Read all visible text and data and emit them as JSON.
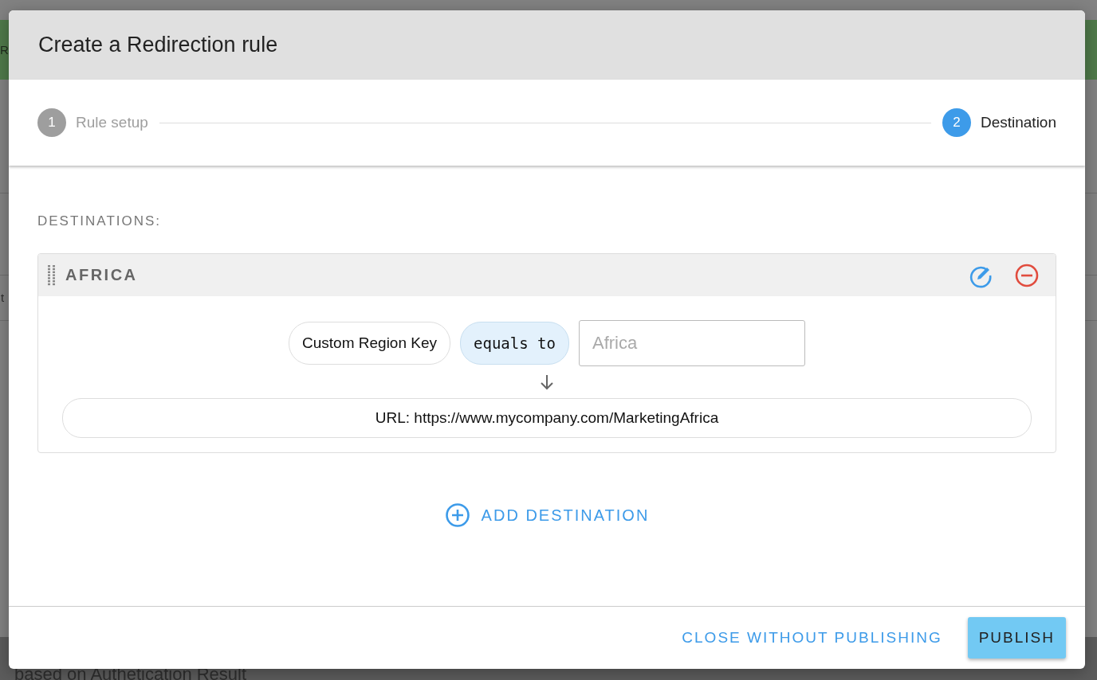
{
  "background": {
    "banner_text": "R",
    "row_text": "t",
    "footer_text": "based on Authetication Result"
  },
  "dialog": {
    "title": "Create a Redirection rule",
    "steps": [
      {
        "number": "1",
        "label": "Rule setup",
        "selected": false
      },
      {
        "number": "2",
        "label": "Destination",
        "selected": true
      }
    ],
    "section_label": "DESTINATIONS:",
    "destinations": [
      {
        "name": "AFRICA",
        "condition": {
          "field": "Custom Region Key",
          "operator": "equals to",
          "placeholder": "Africa"
        },
        "target": "URL: https://www.mycompany.com/MarketingAfrica"
      }
    ],
    "add_label": "ADD DESTINATION",
    "buttons": [
      {
        "label": "CLOSE WITHOUT PUBLISHING",
        "kind": "text"
      },
      {
        "label": "PUBLISH",
        "kind": "primary"
      }
    ]
  }
}
